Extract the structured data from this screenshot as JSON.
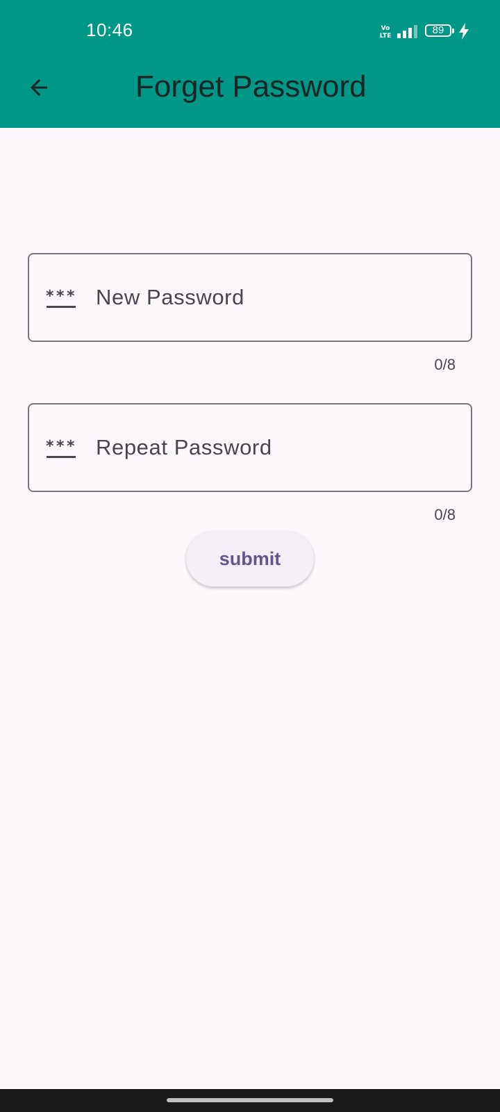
{
  "status_bar": {
    "time": "10:46",
    "network_label": "Vo LTE",
    "battery_level": "89",
    "icons": [
      "volte-icon",
      "signal-icon",
      "battery-icon",
      "charging-icon"
    ]
  },
  "app_bar": {
    "title": "Forget Password",
    "back_icon": "arrow-left-icon",
    "background_color": "#009688"
  },
  "form": {
    "new_password": {
      "placeholder": "New Password",
      "value": "",
      "icon": "password-icon",
      "counter": "0/8"
    },
    "repeat_password": {
      "placeholder": "Repeat Password",
      "value": "",
      "icon": "password-icon",
      "counter": "0/8"
    },
    "submit_label": "submit",
    "accent_color": "#65558f"
  },
  "nav_bar": {
    "indicator": "home-indicator"
  }
}
